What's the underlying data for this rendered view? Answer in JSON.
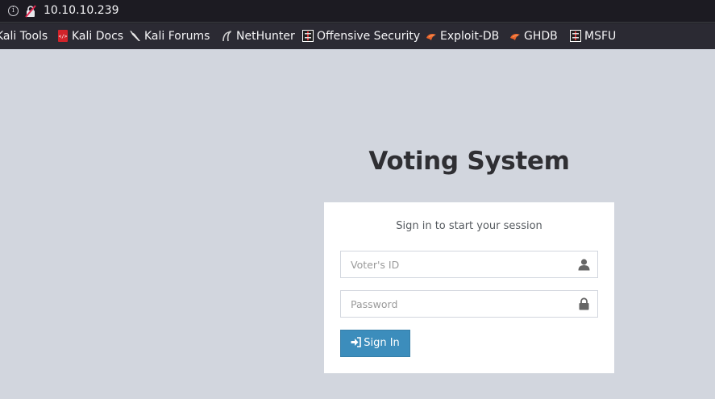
{
  "browser": {
    "url": "10.10.10.239",
    "bookmarks": [
      {
        "label": "Kali Tools",
        "icon": "kali-icon"
      },
      {
        "label": "Kali Docs",
        "icon": "kali-docs-icon"
      },
      {
        "label": "Kali Forums",
        "icon": "kali-dragon-icon"
      },
      {
        "label": "NetHunter",
        "icon": "nethunter-icon"
      },
      {
        "label": "Offensive Security",
        "icon": "offsec-icon"
      },
      {
        "label": "Exploit-DB",
        "icon": "exploit-db-icon"
      },
      {
        "label": "GHDB",
        "icon": "ghdb-icon"
      },
      {
        "label": "MSFU",
        "icon": "msfu-icon"
      }
    ]
  },
  "page": {
    "title": "Voting System",
    "login": {
      "subtitle": "Sign in to start your session",
      "voter_id_placeholder": "Voter's ID",
      "voter_id_value": "",
      "password_placeholder": "Password",
      "password_value": "",
      "sign_in_label": "Sign In"
    }
  },
  "colors": {
    "page_background": "#d2d6de",
    "button_primary": "#3c8dbc",
    "toolbar": "#2b2a33"
  }
}
